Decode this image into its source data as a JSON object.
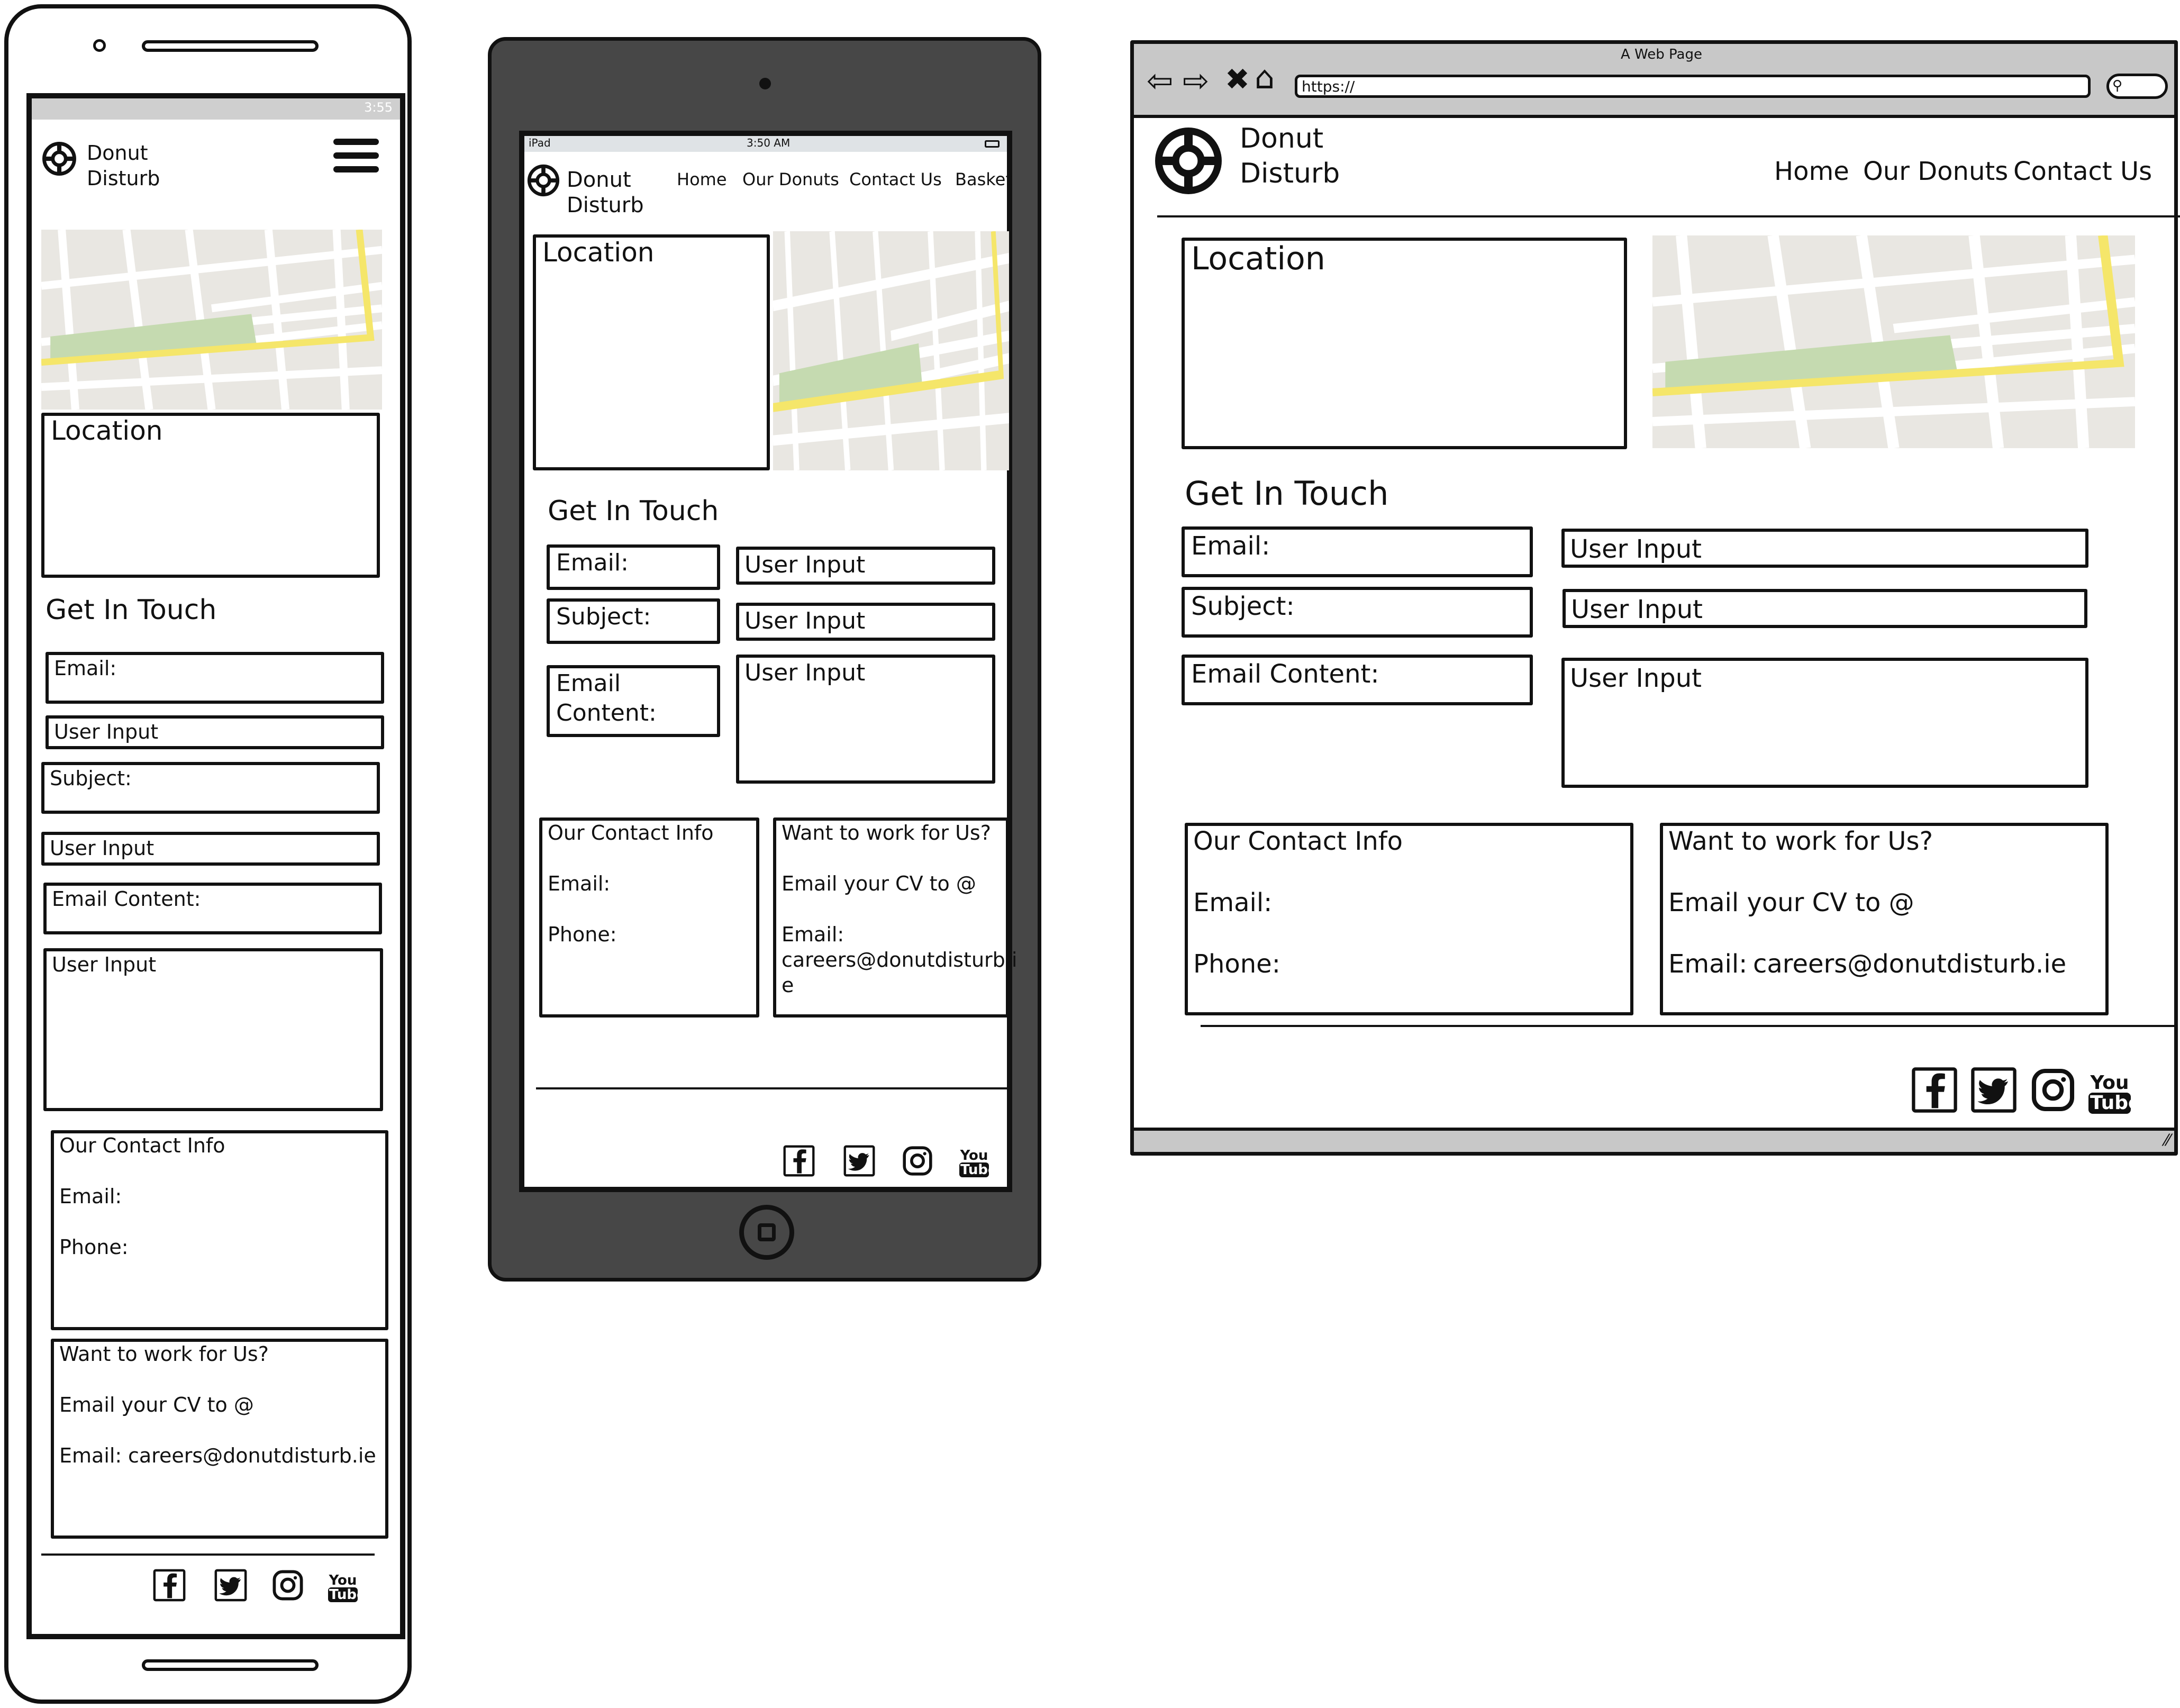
{
  "brand": {
    "line1": "Donut",
    "line2": "Disturb"
  },
  "phone": {
    "status_time": "3:55",
    "location_label": "Location",
    "get_in_touch": "Get In Touch",
    "form": {
      "email_label": "Email:",
      "email_input": "User Input",
      "subject_label": "Subject:",
      "subject_input": "User Input",
      "content_label": "Email Content:",
      "content_input": "User Input"
    },
    "contact": {
      "title": "Our Contact Info",
      "email": "Email:",
      "phone": "Phone:"
    },
    "careers": {
      "title": "Want to work for Us?",
      "cv": "Email your CV to @",
      "email_label": "Email:",
      "email_value": "careers@donutdisturb.ie"
    }
  },
  "tablet": {
    "status_left": "iPad",
    "status_time": "3:50 AM",
    "nav": [
      "Home",
      "Our Donuts",
      "Contact Us",
      "Basket"
    ],
    "location_label": "Location",
    "get_in_touch": "Get In Touch",
    "form": {
      "email_label": "Email:",
      "email_input": "User Input",
      "subject_label": "Subject:",
      "subject_input": "User Input",
      "content_label_1": "Email",
      "content_label_2": "Content:",
      "content_input": "User Input"
    },
    "contact": {
      "title": "Our Contact Info",
      "email": "Email:",
      "phone": "Phone:"
    },
    "careers": {
      "title": "Want to work for Us?",
      "cv": "Email your CV to @",
      "email_label": "Email:",
      "email_line1": "careers@donutdisturb.i",
      "email_line2": "e"
    }
  },
  "browser": {
    "window_title": "A Web Page",
    "url": "https://",
    "nav": [
      "Home",
      "Our Donuts",
      "Contact Us"
    ],
    "location_label": "Location",
    "get_in_touch": "Get In Touch",
    "form": {
      "email_label": "Email:",
      "email_input": "User Input",
      "subject_label": "Subject:",
      "subject_input": "User Input",
      "content_label": "Email Content:",
      "content_input": "User Input"
    },
    "contact": {
      "title": "Our Contact Info",
      "email": "Email:",
      "phone": "Phone:"
    },
    "careers": {
      "title": "Want to work for Us?",
      "cv": "Email your CV to @",
      "email_label": "Email:",
      "email_value": "careers@donutdisturb.ie"
    }
  },
  "social_icons": [
    "facebook-icon",
    "twitter-icon",
    "instagram-icon",
    "youtube-icon"
  ],
  "youtube_badge": {
    "you": "You",
    "tube": "Tube"
  },
  "colors": {
    "map_road": "#ffffff",
    "map_base": "#e9e7e2",
    "map_park": "#c5dab0",
    "map_highway": "#f5e66a",
    "tablet_body": "#474747",
    "chrome_gray": "#c8c8c8"
  }
}
